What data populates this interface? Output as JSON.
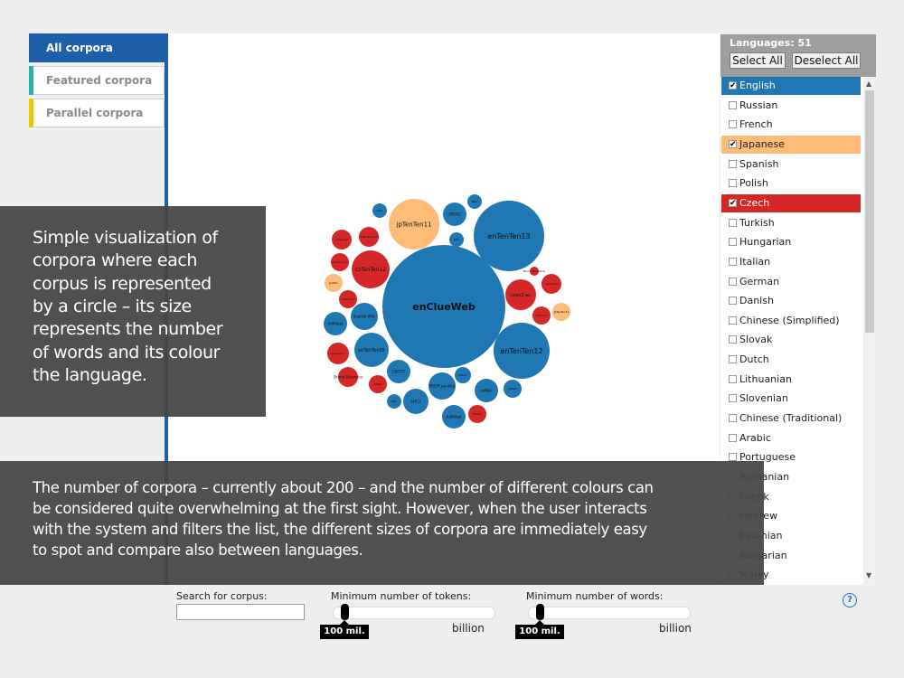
{
  "tabs": [
    {
      "label": "All corpora",
      "active": true
    },
    {
      "label": "Featured corpora",
      "accent": "#2ab2a6"
    },
    {
      "label": "Parallel corpora",
      "accent": "#e8c900"
    }
  ],
  "languages": {
    "count_label": "Languages: 51",
    "select_all": "Select All",
    "deselect_all": "Deselect All",
    "items": [
      {
        "name": "English",
        "checked": true,
        "color": "#1f77b4"
      },
      {
        "name": "Russian",
        "checked": false
      },
      {
        "name": "French",
        "checked": false
      },
      {
        "name": "Japanese",
        "checked": true,
        "color": "#ffbb78"
      },
      {
        "name": "Spanish",
        "checked": false
      },
      {
        "name": "Polish",
        "checked": false
      },
      {
        "name": "Czech",
        "checked": true,
        "color": "#d62728"
      },
      {
        "name": "Turkish",
        "checked": false
      },
      {
        "name": "Hungarian",
        "checked": false
      },
      {
        "name": "Italian",
        "checked": false
      },
      {
        "name": "German",
        "checked": false
      },
      {
        "name": "Danish",
        "checked": false
      },
      {
        "name": "Chinese (Simplified)",
        "checked": false
      },
      {
        "name": "Slovak",
        "checked": false
      },
      {
        "name": "Dutch",
        "checked": false
      },
      {
        "name": "Lithuanian",
        "checked": false
      },
      {
        "name": "Slovenian",
        "checked": false
      },
      {
        "name": "Chinese (Traditional)",
        "checked": false
      },
      {
        "name": "Arabic",
        "checked": false
      },
      {
        "name": "Portuguese",
        "checked": false
      },
      {
        "name": "Romanian",
        "checked": false
      },
      {
        "name": "Greek",
        "checked": false
      },
      {
        "name": "Hebrew",
        "checked": false
      },
      {
        "name": "Estonian",
        "checked": false
      },
      {
        "name": "Bulgarian",
        "checked": false
      },
      {
        "name": "Malay",
        "checked": false
      }
    ]
  },
  "overlay": {
    "caption1_lines": [
      "Simple visualization of",
      "corpora where each",
      "corpus is represented",
      "by a circle –  its size",
      "represents the number",
      "of words and its colour",
      "the language."
    ],
    "caption2_lines": [
      "The number of corpora – currently about 200 – and the number of different colours can",
      "be considered quite overwhelming at the first sight. However, when the user interacts",
      "with the system and filters the list, the different sizes of corpora are immediately easy",
      "to spot and compare also between languages."
    ]
  },
  "controls": {
    "search_label": "Search for corpus:",
    "search_value": "",
    "tokens_label": "Minimum number of tokens:",
    "words_label": "Minimum number of words:",
    "tokens_min_label": "100 mil.",
    "words_min_label": "100 mil.",
    "max_label": "billion",
    "help": "?"
  },
  "bubbles": {
    "colors": {
      "English": "#1f77b4",
      "Japanese": "#ffbb78",
      "Czech": "#d62728"
    },
    "items": [
      {
        "label": "enClueWeb",
        "lang": "English"
      },
      {
        "label": "enTenTen13",
        "lang": "English"
      },
      {
        "label": "enTenTen12",
        "lang": "English"
      },
      {
        "label": "jpTenTen11",
        "lang": "Japanese"
      },
      {
        "label": "czTenTen12",
        "lang": "Czech"
      },
      {
        "label": "czTenTen12.v0",
        "lang": "Czech"
      },
      {
        "label": "enTenTen08",
        "lang": "English"
      },
      {
        "label": "OPUS2",
        "lang": "English"
      },
      {
        "label": "BNC",
        "lang": "English"
      },
      {
        "label": "BNC",
        "lang": "English"
      },
      {
        "label": "WAC",
        "lang": "English"
      },
      {
        "label": "English Wiki",
        "lang": "English"
      },
      {
        "label": "AAMetal",
        "lang": "English"
      },
      {
        "label": "LDOCE",
        "lang": "English"
      },
      {
        "label": "SkELL",
        "lang": "English"
      },
      {
        "label": "PELTR parallel",
        "lang": "English"
      },
      {
        "label": "ukWaC",
        "lang": "English"
      },
      {
        "label": "AAMetal",
        "lang": "English"
      },
      {
        "label": "BNC",
        "lang": "English"
      },
      {
        "label": "NMAC",
        "lang": "English"
      },
      {
        "label": "SkWaC",
        "lang": "English"
      },
      {
        "label": "jpTenTen11",
        "lang": "Japanese"
      },
      {
        "label": "JpWaC",
        "lang": "Japanese"
      },
      {
        "label": "Bruno Bolemica",
        "lang": "Czech"
      },
      {
        "label": "czes2",
        "lang": "Czech"
      },
      {
        "label": "OPUS2",
        "lang": "Czech"
      },
      {
        "label": "czes2-syn",
        "lang": "Czech"
      },
      {
        "label": "czes2-syn-v",
        "lang": "Czech"
      },
      {
        "label": "czes2-sct",
        "lang": "Czech"
      },
      {
        "label": "czes2-sm",
        "lang": "Czech"
      },
      {
        "label": "czes2-sc",
        "lang": "Czech"
      },
      {
        "label": "czes2-syn-c",
        "lang": "Czech"
      },
      {
        "label": "czes2-as",
        "lang": "Czech"
      },
      {
        "label": "Bruno Bolemica",
        "lang": "Czech"
      }
    ]
  }
}
